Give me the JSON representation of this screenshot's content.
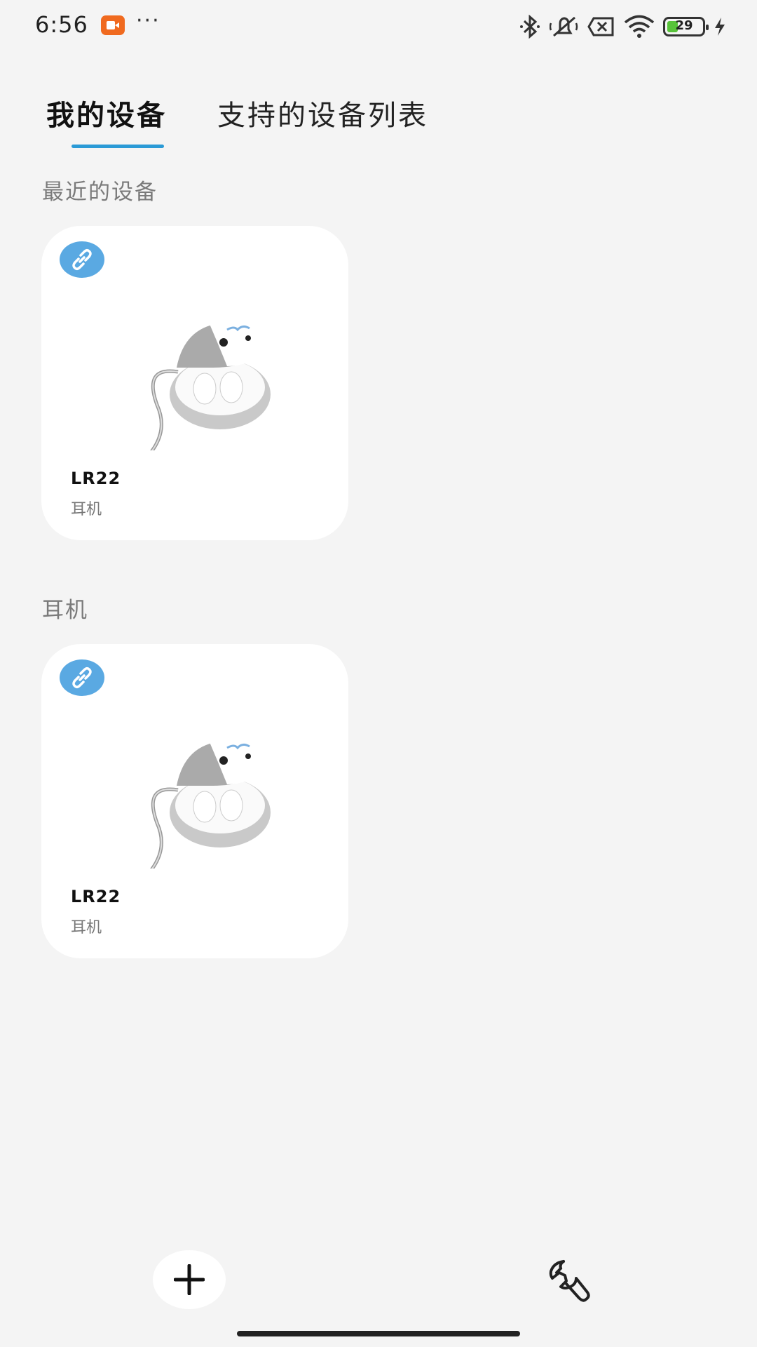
{
  "status_bar": {
    "time": "6:56",
    "more": "···",
    "battery_level": "29",
    "icons": [
      "recording-icon",
      "bluetooth-icon",
      "mute-icon",
      "no-sim-icon",
      "wifi-icon",
      "battery-icon",
      "charging-icon"
    ]
  },
  "tabs": [
    {
      "label": "我的设备",
      "active": true
    },
    {
      "label": "支持的设备列表",
      "active": false
    }
  ],
  "sections": [
    {
      "title": "最近的设备",
      "devices": [
        {
          "name": "LR22",
          "type": "耳机",
          "icon": "link-icon"
        }
      ]
    },
    {
      "title": "耳机",
      "devices": [
        {
          "name": "LR22",
          "type": "耳机",
          "icon": "link-icon"
        }
      ]
    }
  ],
  "bottom_bar": {
    "add_icon": "plus-icon",
    "tools_icon": "wrench-icon"
  },
  "colors": {
    "accent": "#2a9ad6",
    "badge": "#5aa9e2",
    "background": "#f4f4f4",
    "record": "#f06a1f"
  }
}
